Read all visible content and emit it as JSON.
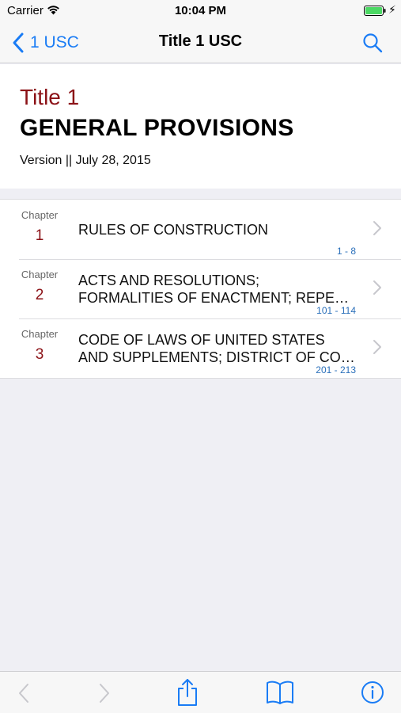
{
  "status_bar": {
    "carrier": "Carrier",
    "time": "10:04 PM"
  },
  "nav": {
    "back_label": "1 USC",
    "title": "Title 1 USC"
  },
  "header": {
    "title_number": "Title 1",
    "heading": "GENERAL PROVISIONS",
    "version": "Version || July 28, 2015"
  },
  "chapters": [
    {
      "word": "Chapter",
      "number": "1",
      "lines": [
        "RULES OF CONSTRUCTION"
      ],
      "range": "1 - 8"
    },
    {
      "word": "Chapter",
      "number": "2",
      "lines": [
        "ACTS AND RESOLUTIONS;",
        "FORMALITIES OF ENACTMENT; REPEA…"
      ],
      "range": "101 - 114"
    },
    {
      "word": "Chapter",
      "number": "3",
      "lines": [
        "CODE OF LAWS OF UNITED STATES",
        "AND SUPPLEMENTS; DISTRICT OF CO…"
      ],
      "range": "201 - 213"
    }
  ],
  "colors": {
    "accent": "#1a7cf5",
    "title_red": "#8b1116",
    "range_blue": "#2a6fba",
    "disabled": "#c7c7cc"
  },
  "toolbar": {
    "icons": [
      "back-arrow-icon",
      "forward-arrow-icon",
      "share-icon",
      "book-icon",
      "info-icon"
    ]
  }
}
